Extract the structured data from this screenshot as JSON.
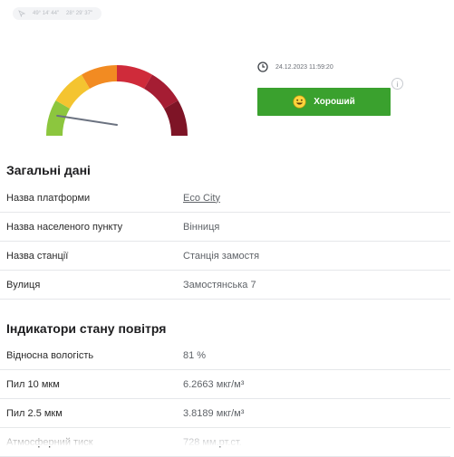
{
  "location": {
    "latitude": "49° 14' 44\"",
    "longitude": "28° 29' 37\""
  },
  "gauge": {
    "aqi_fraction": 0.02,
    "segment_colors": [
      "#8cc63e",
      "#f4c430",
      "#f28b22",
      "#cf2b3a",
      "#a51d33",
      "#7e1426"
    ]
  },
  "measurement": {
    "timestamp": "24.12.2023 11:59:20"
  },
  "status": {
    "label": "Хороший",
    "color": "#3aa12e"
  },
  "general": {
    "title": "Загальні дані",
    "rows": [
      {
        "key": "Назва платформи",
        "value": "Eco City"
      },
      {
        "key": "Назва населеного пункту",
        "value": "Вінниця"
      },
      {
        "key": "Назва станції",
        "value": "Станція замостя"
      },
      {
        "key": "Вулиця",
        "value": "Замостянська 7"
      }
    ]
  },
  "air": {
    "title": "Індикатори стану повітря",
    "rows": [
      {
        "key": "Відносна вологість",
        "value": "81 %"
      },
      {
        "key": "Пил 10 мкм",
        "value": "6.2663 мкг/м³"
      },
      {
        "key": "Пил 2.5 мкм",
        "value": "3.8189 мкг/м³"
      },
      {
        "key": "Атмосферний тиск",
        "value": "728 мм.рт.ст."
      }
    ]
  }
}
